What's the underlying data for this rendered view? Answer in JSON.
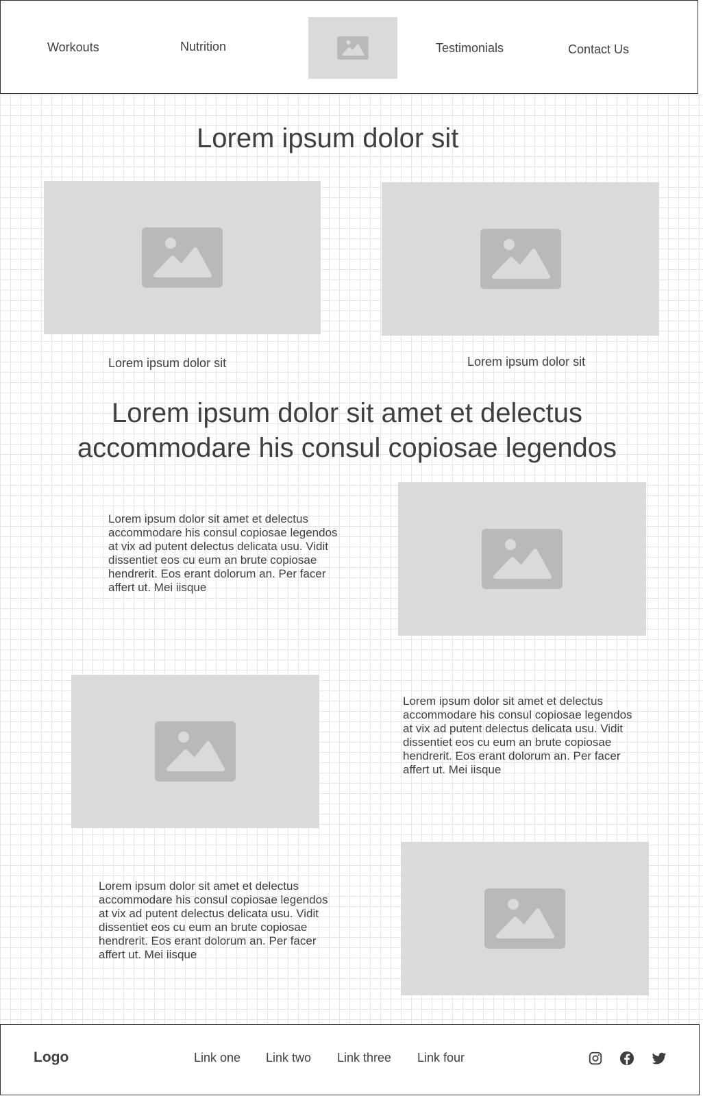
{
  "header": {
    "nav": [
      "Workouts",
      "Nutrition",
      "Testimonials",
      "Contact Us"
    ],
    "logo_icon": "image-placeholder-icon"
  },
  "main": {
    "title": "Lorem ipsum dolor sit",
    "cards": [
      {
        "caption": "Lorem ipsum dolor sit",
        "icon": "image-placeholder-icon"
      },
      {
        "caption": "Lorem ipsum dolor sit",
        "icon": "image-placeholder-icon"
      }
    ],
    "subtitle_line1": "Lorem ipsum dolor sit amet et delectus",
    "subtitle_line2": "accommodare his consul copiosae legendos",
    "rows": [
      {
        "text": "Lorem ipsum dolor sit amet et delectus accommodare his consul copiosae legendos at vix ad putent delectus delicata usu. Vidit dissentiet eos cu eum an brute copiosae hendrerit. Eos erant dolorum an. Per facer affert ut. Mei iisque"
      },
      {
        "text": "Lorem ipsum dolor sit amet et delectus accommodare his consul copiosae legendos at vix ad putent delectus delicata usu. Vidit dissentiet eos cu eum an brute copiosae hendrerit. Eos erant dolorum an. Per facer affert ut. Mei iisque"
      },
      {
        "text": "Lorem ipsum dolor sit amet et delectus accommodare his consul copiosae legendos at vix ad putent delectus delicata usu. Vidit dissentiet eos cu eum an brute copiosae hendrerit. Eos erant dolorum an. Per facer affert ut. Mei iisque"
      }
    ]
  },
  "footer": {
    "logo": "Logo",
    "links": [
      "Link one",
      "Link two",
      "Link three",
      "Link four"
    ],
    "social_icons": [
      "instagram-icon",
      "facebook-icon",
      "twitter-icon"
    ]
  },
  "colors": {
    "placeholder_bg": "#dadada",
    "placeholder_icon": "#b9b9b9",
    "text": "#3f3f3f",
    "grid_line": "#e6e6e6",
    "border": "#333333"
  }
}
